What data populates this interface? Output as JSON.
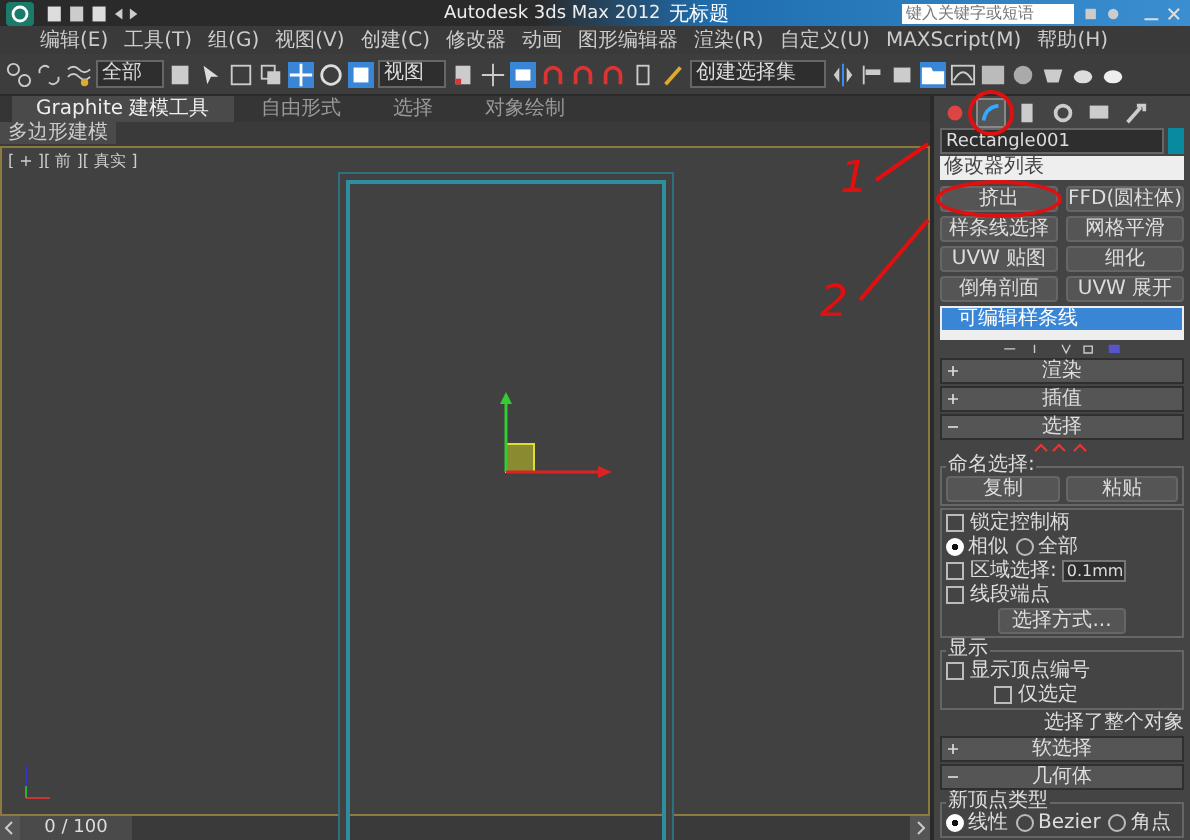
{
  "window": {
    "title": "Autodesk 3ds Max 2012",
    "doc_title": "无标题",
    "search": {
      "placeholder": "键入关键字或短语"
    }
  },
  "menu": [
    "编辑(E)",
    "工具(T)",
    "组(G)",
    "视图(V)",
    "创建(C)",
    "修改器",
    "动画",
    "图形编辑器",
    "渲染(R)",
    "自定义(U)",
    "MAXScript(M)",
    "帮助(H)"
  ],
  "toolbar": {
    "filter": "全部",
    "coord": "视图",
    "selection_set": "创建选择集"
  },
  "ribbon": {
    "tabs": [
      {
        "label": "Graphite 建模工具",
        "selected": true
      },
      {
        "label": "自由形式",
        "selected": false
      },
      {
        "label": "选择",
        "selected": false
      },
      {
        "label": "对象绘制",
        "selected": false
      }
    ],
    "panel": "多边形建模"
  },
  "viewport": {
    "label": "[ + ][ 前 ][ 真实 ]"
  },
  "timeline": {
    "frame": "0 / 100",
    "level": 0
  },
  "annotations": [
    {
      "label": "1"
    },
    {
      "label": "2"
    }
  ],
  "command_panel": {
    "tabs": [
      {
        "kind": "create",
        "selected": false
      },
      {
        "kind": "modify",
        "selected": true
      },
      {
        "kind": "hierarchy",
        "selected": false
      },
      {
        "kind": "motion",
        "selected": false
      },
      {
        "kind": "display",
        "selected": false
      },
      {
        "kind": "utilities",
        "selected": false
      }
    ],
    "object_name": "Rectangle001",
    "modifier_list": "修改器列表",
    "modifier_buttons": [
      "挤出",
      "FFD(圆柱体)",
      "样条线选择",
      "网格平滑",
      "UVW 贴图",
      "细化",
      "倒角剖面",
      "UVW 展开"
    ],
    "stack": [
      {
        "label": "可编辑样条线",
        "selected": true
      }
    ],
    "rollouts": [
      {
        "label": "渲染",
        "expanded": false
      },
      {
        "label": "插值",
        "expanded": false
      },
      {
        "label": "选择",
        "expanded": true
      }
    ],
    "selection": {
      "named_group": "命名选择:",
      "copy": "复制",
      "paste": "粘贴",
      "lock_handles": {
        "label": "锁定控制柄",
        "checked": false
      },
      "radios": [
        {
          "label": "相似",
          "selected": true
        },
        {
          "label": "全部",
          "selected": false
        }
      ],
      "area_select": {
        "label": "区域选择:",
        "checked": false,
        "value": "0.1mm"
      },
      "segment_end": {
        "label": "线段端点",
        "checked": false
      },
      "select_by": "选择方式...",
      "display_group": "显示",
      "show_vertex_numbers": {
        "label": "显示顶点编号",
        "checked": false
      },
      "selected_only": {
        "label": "仅选定",
        "checked": false
      },
      "status": "选择了整个对象"
    },
    "rollouts2": [
      {
        "label": "软选择",
        "expanded": false
      },
      {
        "label": "几何体",
        "expanded": true
      }
    ],
    "new_vertex": {
      "group": "新顶点类型",
      "options": [
        {
          "label": "线性",
          "selected": true
        },
        {
          "label": "Bezier",
          "selected": false
        },
        {
          "label": "角点",
          "selected": false
        }
      ]
    }
  }
}
